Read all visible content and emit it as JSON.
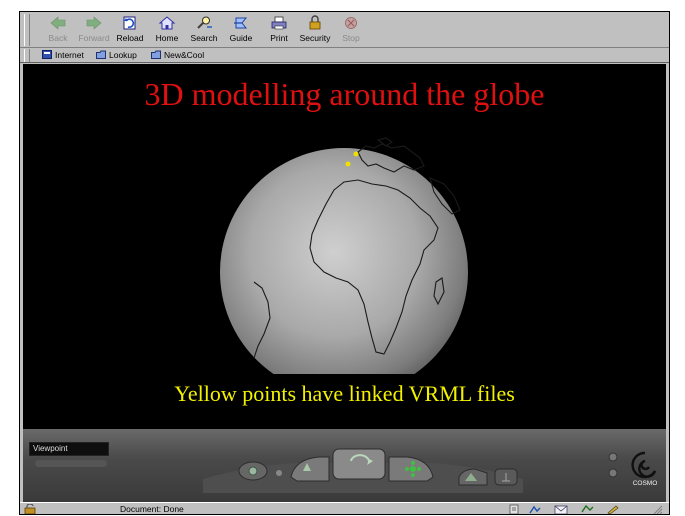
{
  "toolbar": {
    "buttons": [
      {
        "label": "Back",
        "icon": "back-arrow-icon",
        "enabled": false
      },
      {
        "label": "Forward",
        "icon": "forward-arrow-icon",
        "enabled": false
      },
      {
        "label": "Reload",
        "icon": "reload-icon",
        "enabled": true
      },
      {
        "label": "Home",
        "icon": "home-icon",
        "enabled": true
      },
      {
        "label": "Search",
        "icon": "search-icon",
        "enabled": true
      },
      {
        "label": "Guide",
        "icon": "guide-icon",
        "enabled": true
      },
      {
        "label": "Print",
        "icon": "print-icon",
        "enabled": true
      },
      {
        "label": "Security",
        "icon": "lock-icon",
        "enabled": true
      },
      {
        "label": "Stop",
        "icon": "stop-icon",
        "enabled": false
      }
    ]
  },
  "personal_bar": {
    "items": [
      {
        "label": "Internet",
        "icon": "bookmark-icon"
      },
      {
        "label": "Lookup",
        "icon": "bookmark-icon"
      },
      {
        "label": "New&Cool",
        "icon": "bookmark-icon"
      }
    ]
  },
  "scene": {
    "title": "3D modelling around the globe",
    "caption": "Yellow points have linked VRML files",
    "colors": {
      "background": "#000000",
      "title": "#e01010",
      "caption": "#f2f200",
      "linked_point": "#f0e000"
    }
  },
  "vrml_controls": {
    "viewpoint_value": "Viewpoint",
    "brand": "COSMO"
  },
  "status": {
    "text": "Document: Done"
  }
}
